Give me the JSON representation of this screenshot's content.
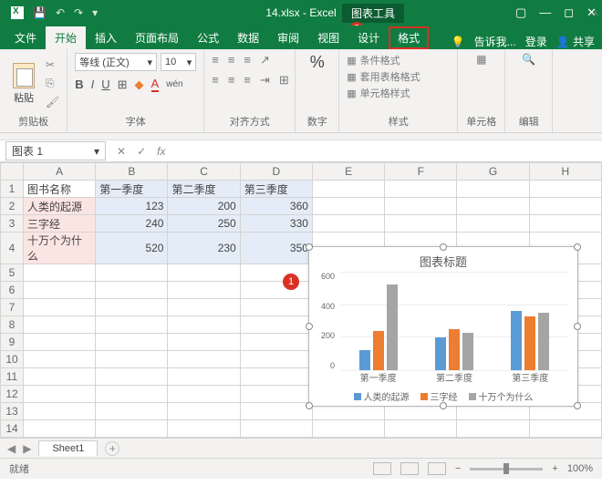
{
  "titlebar": {
    "filename": "14.xlsx - Excel",
    "chart_tools": "图表工具"
  },
  "callouts": {
    "c1": "1",
    "c2": "2"
  },
  "tabs": {
    "file": "文件",
    "home": "开始",
    "insert": "插入",
    "layout": "页面布局",
    "formulas": "公式",
    "data": "数据",
    "review": "审阅",
    "view": "视图",
    "design": "设计",
    "format": "格式",
    "tell": "告诉我...",
    "signin": "登录",
    "share": "共享"
  },
  "ribbon": {
    "clipboard": {
      "label": "剪贴板",
      "paste": "粘贴"
    },
    "font": {
      "label": "字体",
      "name": "等线 (正文)",
      "size": "10",
      "bold": "B",
      "italic": "I",
      "underline": "U",
      "border": "⊞",
      "fill": "◆",
      "color": "A",
      "wen": "wén"
    },
    "align": {
      "label": "对齐方式"
    },
    "number": {
      "label": "数字",
      "pct": "%"
    },
    "styles": {
      "label": "样式",
      "cond": "条件格式",
      "table": "套用表格格式",
      "cell": "单元格样式"
    },
    "cells": {
      "label": "单元格"
    },
    "editing": {
      "label": "编辑"
    }
  },
  "namebox": {
    "value": "图表 1",
    "fx": "fx"
  },
  "sheet": {
    "cols": [
      "A",
      "B",
      "C",
      "D",
      "E",
      "F",
      "G",
      "H"
    ],
    "headers": {
      "a": "图书名称",
      "b": "第一季度",
      "c": "第二季度",
      "d": "第三季度"
    },
    "rows": [
      {
        "a": "人类的起源",
        "b": "123",
        "c": "200",
        "d": "360"
      },
      {
        "a": "三字经",
        "b": "240",
        "c": "250",
        "d": "330"
      },
      {
        "a": "十万个为什么",
        "b": "520",
        "c": "230",
        "d": "350"
      }
    ]
  },
  "chart": {
    "title": "图表标题",
    "yticks": [
      "600",
      "400",
      "200",
      "0"
    ],
    "xlabels": [
      "第一季度",
      "第二季度",
      "第三季度"
    ],
    "legend": [
      "人类的起源",
      "三字经",
      "十万个为什么"
    ]
  },
  "chart_data": {
    "type": "bar",
    "title": "图表标题",
    "categories": [
      "第一季度",
      "第二季度",
      "第三季度"
    ],
    "series": [
      {
        "name": "人类的起源",
        "values": [
          123,
          200,
          360
        ]
      },
      {
        "name": "三字经",
        "values": [
          240,
          250,
          330
        ]
      },
      {
        "name": "十万个为什么",
        "values": [
          520,
          230,
          350
        ]
      }
    ],
    "ylim": [
      0,
      600
    ],
    "xlabel": "",
    "ylabel": ""
  },
  "sheettab": {
    "name": "Sheet1"
  },
  "status": {
    "ready": "就绪",
    "zoom": "100%"
  }
}
